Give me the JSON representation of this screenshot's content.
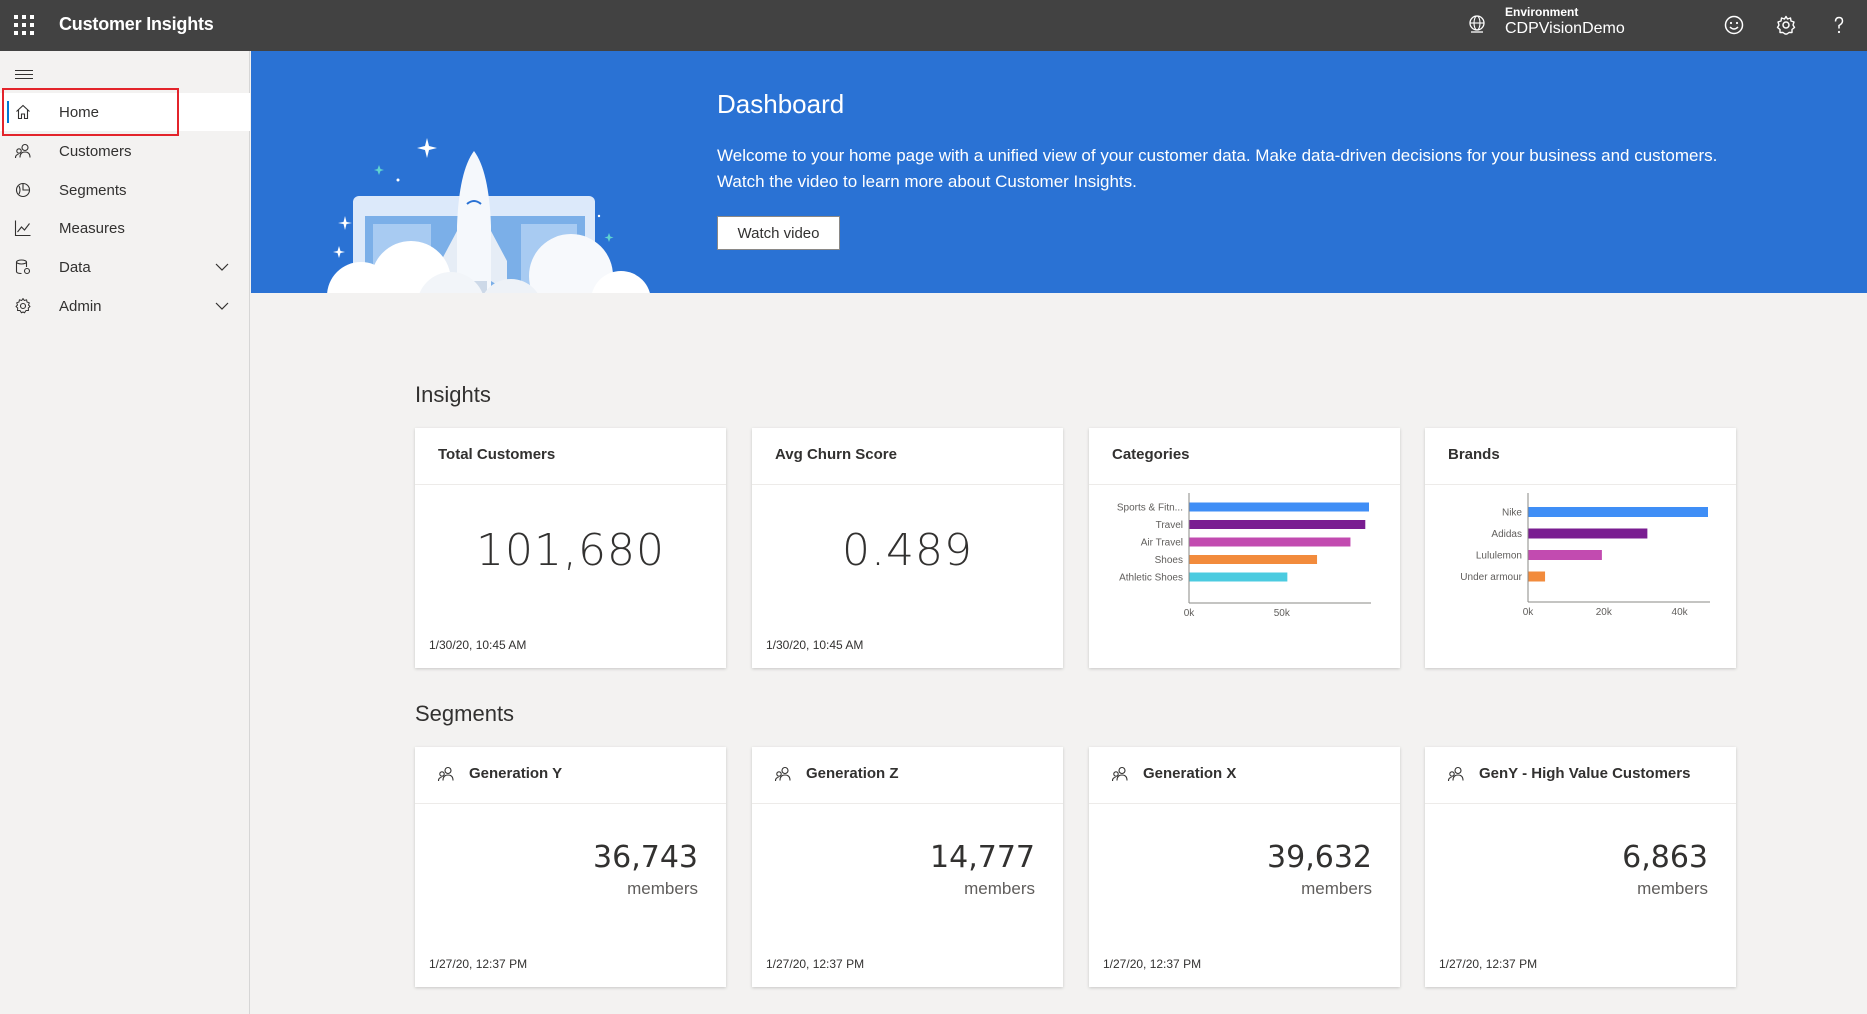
{
  "app": {
    "title": "Customer Insights"
  },
  "environment": {
    "label": "Environment",
    "value": "CDPVisionDemo"
  },
  "header_icons": [
    "globe-icon",
    "smiley-feedback-icon",
    "gear-icon",
    "help-icon"
  ],
  "sidebar": {
    "items": [
      {
        "label": "Home",
        "icon": "home-icon",
        "active": true,
        "expandable": false
      },
      {
        "label": "Customers",
        "icon": "customers-icon",
        "active": false,
        "expandable": false
      },
      {
        "label": "Segments",
        "icon": "segments-icon",
        "active": false,
        "expandable": false
      },
      {
        "label": "Measures",
        "icon": "measures-icon",
        "active": false,
        "expandable": false
      },
      {
        "label": "Data",
        "icon": "data-icon",
        "active": false,
        "expandable": true
      },
      {
        "label": "Admin",
        "icon": "admin-gear-icon",
        "active": false,
        "expandable": true
      }
    ]
  },
  "hero": {
    "title": "Dashboard",
    "text": "Welcome to your home page with a unified view of your customer data. Make data-driven decisions for your business and customers. Watch the video to learn more about Customer Insights.",
    "button": "Watch video"
  },
  "insights": {
    "title": "Insights",
    "cards": [
      {
        "title": "Total Customers",
        "value": "101,680",
        "date": "1/30/20, 10:45 AM"
      },
      {
        "title": "Avg Churn Score",
        "value": "0.489",
        "date": "1/30/20, 10:45 AM"
      },
      {
        "title": "Categories"
      },
      {
        "title": "Brands"
      }
    ]
  },
  "segments": {
    "title": "Segments",
    "cards": [
      {
        "title": "Generation Y",
        "count": "36,743",
        "unit": "members",
        "date": "1/27/20, 12:37 PM"
      },
      {
        "title": "Generation Z",
        "count": "14,777",
        "unit": "members",
        "date": "1/27/20, 12:37 PM"
      },
      {
        "title": "Generation X",
        "count": "39,632",
        "unit": "members",
        "date": "1/27/20, 12:37 PM"
      },
      {
        "title": "GenY - High Value Customers",
        "count": "6,863",
        "unit": "members",
        "date": "1/27/20, 12:37 PM"
      }
    ]
  },
  "chart_data": [
    {
      "type": "bar",
      "orientation": "horizontal",
      "title": "Categories",
      "categories": [
        "Sports & Fitn...",
        "Travel",
        "Air Travel",
        "Shoes",
        "Athletic Shoes"
      ],
      "values": [
        97000,
        95000,
        87000,
        69000,
        53000
      ],
      "colors": [
        "#3f8ef6",
        "#7a1d91",
        "#c24bb0",
        "#f28b3c",
        "#4bcbe0"
      ],
      "xticks": [
        "0k",
        "50k"
      ],
      "tick_values": [
        0,
        50000
      ],
      "xlim": [
        0,
        97000
      ]
    },
    {
      "type": "bar",
      "orientation": "horizontal",
      "title": "Brands",
      "categories": [
        "Nike",
        "Adidas",
        "Lululemon",
        "Under armour"
      ],
      "values": [
        47500,
        31500,
        19500,
        4500
      ],
      "colors": [
        "#3f8ef6",
        "#7a1d91",
        "#c24bb0",
        "#f28b3c"
      ],
      "xticks": [
        "0k",
        "20k",
        "40k"
      ],
      "tick_values": [
        0,
        20000,
        40000
      ],
      "xlim": [
        0,
        47500
      ]
    }
  ]
}
